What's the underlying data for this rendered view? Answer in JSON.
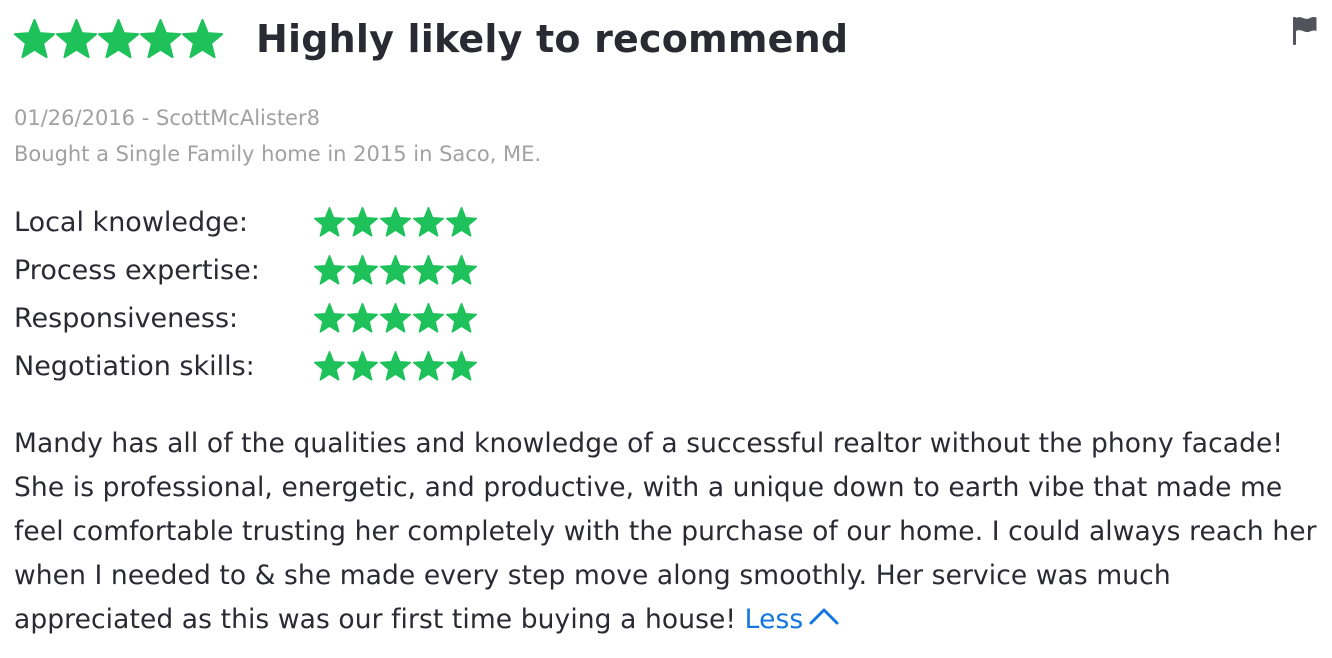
{
  "review": {
    "overall_rating": 5,
    "rating_max": 5,
    "headline": "Highly likely to recommend",
    "date": "01/26/2016",
    "separator": " - ",
    "author": "ScottMcAlister8",
    "transaction": "Bought a Single Family home in 2015 in Saco, ME.",
    "sub_ratings": [
      {
        "label": "Local knowledge:",
        "stars": 5
      },
      {
        "label": "Process expertise:",
        "stars": 5
      },
      {
        "label": "Responsiveness:",
        "stars": 5
      },
      {
        "label": "Negotiation skills:",
        "stars": 5
      }
    ],
    "text": "Mandy has all of the qualities and knowledge of a successful realtor without the phony facade! She is professional, energetic, and productive, with a unique down to earth vibe that made me feel comfortable trusting her completely with the purchase of our home. I could always reach her when I needed to & she made every step move along smoothly. Her service was much appreciated as this was our first time buying a house!",
    "less_label": "Less"
  },
  "icons": {
    "star": "star-icon",
    "flag": "flag-icon",
    "less": "chevron-up-icon"
  },
  "colors": {
    "star_green": "#1ec15a",
    "link_blue": "#1277e1",
    "meta_gray": "#a1a1a1",
    "text_dark": "#2a2a33",
    "flag_gray": "#53535c"
  }
}
